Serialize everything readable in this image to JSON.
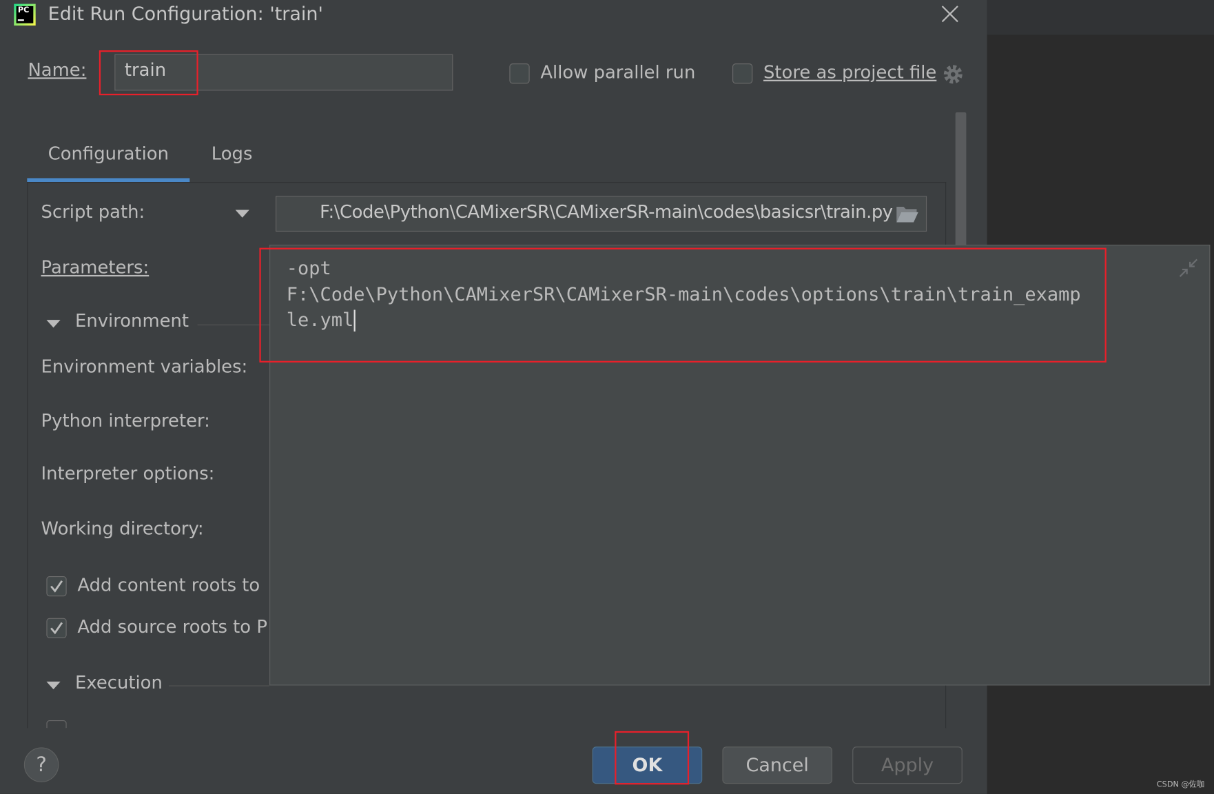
{
  "window": {
    "title": "Edit Run Configuration: 'train'",
    "app_icon": "pycharm-icon",
    "close_icon": "close-icon"
  },
  "header": {
    "name_label": "Name:",
    "name_value": "train",
    "allow_parallel_run": {
      "label": "Allow parallel run",
      "checked": false
    },
    "store_as_project_file": {
      "label": "Store as project file",
      "checked": false
    }
  },
  "tabs": [
    {
      "label": "Configuration",
      "active": true
    },
    {
      "label": "Logs",
      "active": false
    }
  ],
  "form": {
    "script_path_label": "Script path:",
    "script_path_value": "F:\\Code\\Python\\CAMixerSR\\CAMixerSR-main\\codes\\basicsr\\train.py",
    "script_path_visible": ":\\Code\\Python\\CAMixerSR\\CAMixerSR-main\\codes\\basicsr\\train.py",
    "parameters_label": "Parameters:",
    "environment_section": "Environment",
    "environment_variables_label": "Environment variables:",
    "python_interpreter_label": "Python interpreter:",
    "interpreter_options_label": "Interpreter options:",
    "working_directory_label": "Working directory:",
    "add_content_roots": {
      "label": "Add content roots to",
      "checked": true
    },
    "add_source_roots": {
      "label": "Add source roots to P",
      "checked": true
    },
    "execution_section": "Execution"
  },
  "parameters_editor": {
    "lines": [
      "-opt",
      "F:\\Code\\Python\\CAMixerSR\\CAMixerSR-main\\codes\\options\\train\\train_examp",
      "le.yml"
    ]
  },
  "footer": {
    "help": "?",
    "ok": "OK",
    "cancel": "Cancel",
    "apply": "Apply"
  },
  "watermark": "CSDN @佐咖",
  "colors": {
    "accent": "#4a88c7",
    "ok_button": "#365880",
    "highlight_box": "#e8202a"
  }
}
